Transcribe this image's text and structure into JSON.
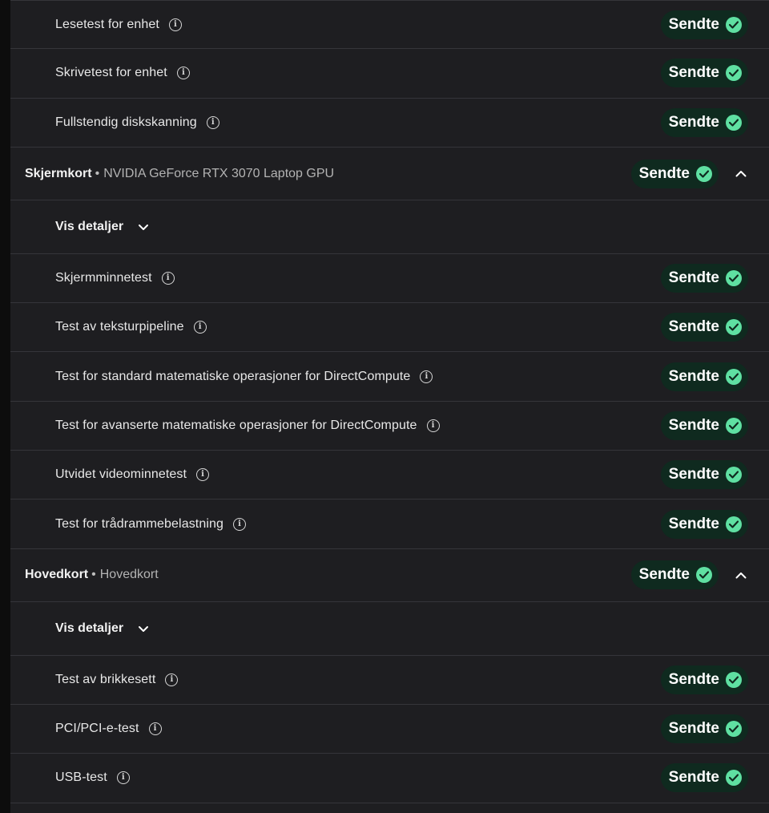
{
  "status_label": "Sendte",
  "colors": {
    "success": "#5fe0a2",
    "badge_bg": "#0f2a1f",
    "panel_bg": "#1e1e21"
  },
  "rows_top": [
    {
      "label": "Lesetest for enhet"
    },
    {
      "label": "Skrivetest for enhet"
    },
    {
      "label": "Fullstendig diskskanning"
    }
  ],
  "gpu": {
    "name": "Skjermkort",
    "separator": "•",
    "device": "NVIDIA GeForce RTX 3070 Laptop GPU",
    "details_label": "Vis detaljer",
    "tests": [
      {
        "label": "Skjermminnetest"
      },
      {
        "label": "Test av teksturpipeline"
      },
      {
        "label": "Test for standard matematiske operasjoner for DirectCompute"
      },
      {
        "label": "Test for avanserte matematiske operasjoner for DirectCompute"
      },
      {
        "label": "Utvidet videominnetest"
      },
      {
        "label": "Test for trådrammebelastning"
      }
    ]
  },
  "motherboard": {
    "name": "Hovedkort",
    "separator": "•",
    "device": "Hovedkort",
    "details_label": "Vis detaljer",
    "tests": [
      {
        "label": "Test av brikkesett"
      },
      {
        "label": "PCI/PCI-e-test"
      },
      {
        "label": "USB-test"
      }
    ]
  },
  "icons": {
    "info": "info-icon",
    "check": "check-circle-icon",
    "expand": "chevron-down-icon",
    "collapse": "chevron-up-icon"
  }
}
